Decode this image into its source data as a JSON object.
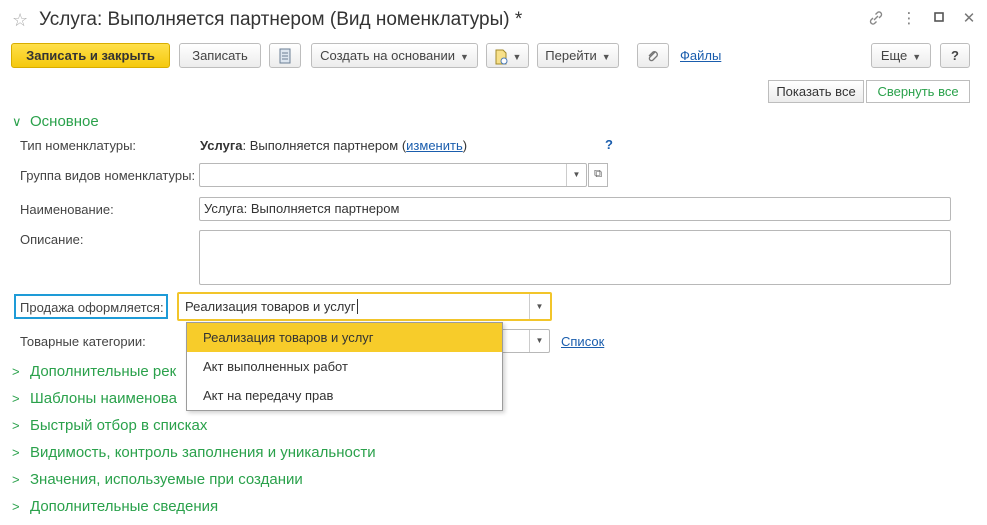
{
  "window": {
    "title": "Услуга: Выполняется партнером (Вид номенклатуры) *"
  },
  "toolbar": {
    "save_close": "Записать и закрыть",
    "save": "Записать",
    "create_based": "Создать на основании",
    "go": "Перейти",
    "files": "Файлы",
    "more": "Еще",
    "help": "?"
  },
  "view_buttons": {
    "show_all": "Показать все",
    "collapse_all": "Свернуть все"
  },
  "main_section": {
    "title": "Основное",
    "type_label": "Тип номенклатуры:",
    "type_value_bold": "Услуга",
    "type_value_rest": ": Выполняется партнером (",
    "type_change_link": "изменить",
    "type_close": ")",
    "type_help": "?",
    "group_label": "Группа видов номенклатуры:",
    "group_value": "",
    "name_label": "Наименование:",
    "name_value": "Услуга: Выполняется партнером",
    "desc_label": "Описание:",
    "desc_value": "",
    "sale_label": "Продажа оформляется:",
    "sale_value": "Реализация товаров и услуг",
    "categories_label": "Товарные категории:",
    "categories_link": "Список"
  },
  "sale_options": [
    "Реализация товаров и услуг",
    "Акт выполненных работ",
    "Акт на передачу прав"
  ],
  "sections": [
    "Дополнительные рек",
    "Шаблоны наименова",
    "Быстрый отбор в списках",
    "Видимость, контроль заполнения и уникальности",
    "Значения, используемые при создании",
    "Дополнительные сведения"
  ],
  "colors": {
    "accent_green": "#2aa14b",
    "primary_yellow": "#f5c90e",
    "highlight_blue": "#1e9bd7",
    "link_blue": "#1a5dad"
  }
}
